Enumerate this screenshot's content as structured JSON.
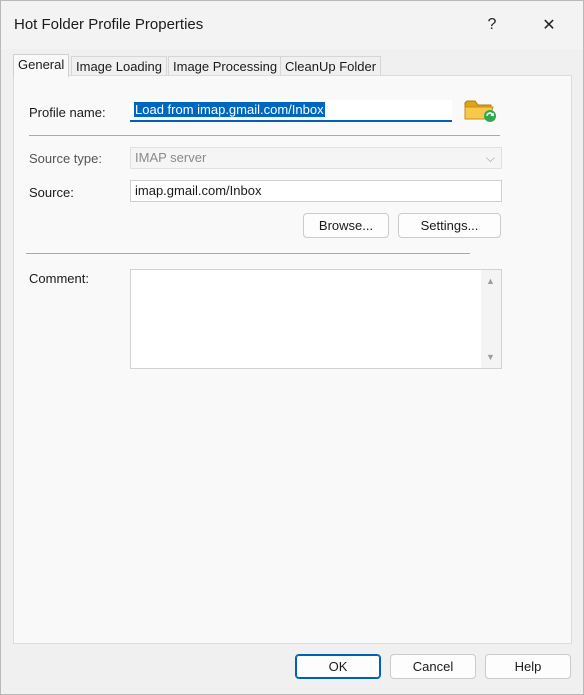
{
  "window": {
    "title": "Hot Folder Profile Properties",
    "help_glyph": "?",
    "close_glyph": "✕"
  },
  "tabs": [
    {
      "label": "General"
    },
    {
      "label": "Image Loading"
    },
    {
      "label": "Image Processing"
    },
    {
      "label": "CleanUp Folder"
    }
  ],
  "general": {
    "profile_name_label": "Profile name:",
    "profile_name_value": "Load from imap.gmail.com/Inbox",
    "source_type_label": "Source type:",
    "source_type_value": "IMAP server",
    "source_label": "Source:",
    "source_value": "imap.gmail.com/Inbox",
    "browse_label": "Browse...",
    "settings_label": "Settings...",
    "comment_label": "Comment:",
    "comment_value": ""
  },
  "footer": {
    "ok_label": "OK",
    "cancel_label": "Cancel",
    "help_label": "Help"
  },
  "colors": {
    "accent": "#0067c0"
  },
  "icons": {
    "profile": "folder-refresh-icon",
    "dropdown": "chevron-down-icon",
    "close": "close-icon",
    "help": "help-icon"
  }
}
